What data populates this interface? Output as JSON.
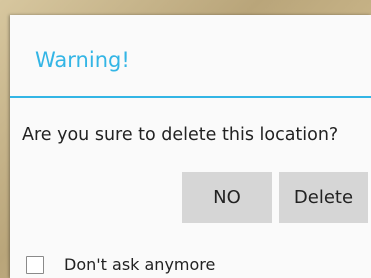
{
  "dialog": {
    "title": "Warning!",
    "message": "Are you sure to delete this location?",
    "no_label": "NO",
    "delete_label": "Delete",
    "checkbox_label": "Don't ask anymore",
    "checkbox_checked": false
  },
  "colors": {
    "accent": "#33b5e5",
    "button_bg": "#d6d6d6",
    "dialog_bg": "#fafafa"
  }
}
